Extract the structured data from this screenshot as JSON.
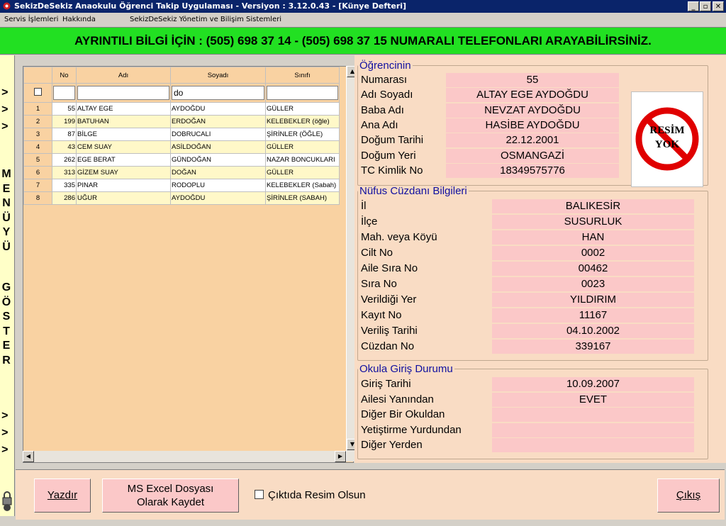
{
  "window": {
    "title": "SekizDeSekiz Anaokulu Öğrenci Takip Uygulaması - Versiyon : 3.12.0.43 - [Künye Defteri]",
    "min_label": "_",
    "max_label": "▫",
    "close_label": "✕"
  },
  "menu": {
    "items": [
      "Servis İşlemleri",
      "Hakkında",
      "SekizDeSekiz Yönetim ve Bilişim Sistemleri"
    ]
  },
  "banner": "AYRINTILI BİLGİ İÇİN : (505) 698 37 14 - (505) 698 37 15 NUMARALI TELEFONLARI ARAYABİLİRSİNİZ.",
  "sidebar": {
    "arrows": ">",
    "menu_letters": [
      "M",
      "E",
      "N",
      "Ü",
      "Y",
      "Ü"
    ],
    "show_letters": [
      "G",
      "Ö",
      "S",
      "T",
      "E",
      "R"
    ]
  },
  "grid": {
    "columns": [
      "No",
      "Adı",
      "Soyadı",
      "Sınıfı"
    ],
    "filter_soyadi": "do",
    "rows": [
      {
        "idx": "1",
        "no": "55",
        "adi": "ALTAY EGE",
        "soyadi": "AYDOĞDU",
        "sinifi": "GÜLLER"
      },
      {
        "idx": "2",
        "no": "199",
        "adi": "BATUHAN",
        "soyadi": "ERDOĞAN",
        "sinifi": "KELEBEKLER (öğle)"
      },
      {
        "idx": "3",
        "no": "87",
        "adi": "BİLGE",
        "soyadi": "DOBRUCALI",
        "sinifi": "ŞİRİNLER (ÖĞLE)"
      },
      {
        "idx": "4",
        "no": "43",
        "adi": "CEM SUAY",
        "soyadi": "ASİLDOĞAN",
        "sinifi": "GÜLLER"
      },
      {
        "idx": "5",
        "no": "262",
        "adi": "EGE BERAT",
        "soyadi": "GÜNDOĞAN",
        "sinifi": "NAZAR BONCUKLARI"
      },
      {
        "idx": "6",
        "no": "313",
        "adi": "GİZEM SUAY",
        "soyadi": "DOĞAN",
        "sinifi": "GÜLLER"
      },
      {
        "idx": "7",
        "no": "335",
        "adi": "PINAR",
        "soyadi": "RODOPLU",
        "sinifi": "KELEBEKLER (Sabah)"
      },
      {
        "idx": "8",
        "no": "286",
        "adi": "UĞUR",
        "soyadi": "AYDOĞDU",
        "sinifi": "ŞİRİNLER (SABAH)"
      }
    ]
  },
  "student": {
    "legend": "Öğrencinin",
    "fields": [
      {
        "label": "Numarası",
        "value": "55"
      },
      {
        "label": "Adı Soyadı",
        "value": "ALTAY EGE AYDOĞDU"
      },
      {
        "label": "Baba Adı",
        "value": "NEVZAT AYDOĞDU"
      },
      {
        "label": "Ana Adı",
        "value": "HASİBE AYDOĞDU"
      },
      {
        "label": "Doğum Tarihi",
        "value": "22.12.2001"
      },
      {
        "label": "Doğum Yeri",
        "value": "OSMANGAZİ"
      },
      {
        "label": "TC Kimlik No",
        "value": "18349575776"
      }
    ],
    "photo_text_1": "RESİM",
    "photo_text_2": "YOK"
  },
  "nufus": {
    "legend": "Nüfus Cüzdanı Bilgileri",
    "fields": [
      {
        "label": "İl",
        "value": "BALIKESİR"
      },
      {
        "label": "İlçe",
        "value": "SUSURLUK"
      },
      {
        "label": "Mah. veya Köyü",
        "value": "HAN"
      },
      {
        "label": "Cilt No",
        "value": "0002"
      },
      {
        "label": "Aile Sıra No",
        "value": "00462"
      },
      {
        "label": "Sıra No",
        "value": "0023"
      },
      {
        "label": "Verildiği Yer",
        "value": "YILDIRIM"
      },
      {
        "label": "Kayıt No",
        "value": "11167"
      },
      {
        "label": "Veriliş Tarihi",
        "value": "04.10.2002"
      },
      {
        "label": "Cüzdan No",
        "value": "339167"
      }
    ]
  },
  "okul": {
    "legend": "Okula Giriş Durumu",
    "fields": [
      {
        "label": "Giriş Tarihi",
        "value": "10.09.2007"
      },
      {
        "label": "Ailesi Yanından",
        "value": "EVET"
      },
      {
        "label": "Diğer Bir Okuldan",
        "value": ""
      },
      {
        "label": "Yetiştirme Yurdundan",
        "value": ""
      },
      {
        "label": "Diğer Yerden",
        "value": ""
      }
    ]
  },
  "bottom": {
    "print": "Yazdır",
    "excel_1": "MS Excel Dosyası",
    "excel_2": "Olarak Kaydet",
    "photo_option": "Çıktıda Resim Olsun",
    "exit": "Çıkış"
  },
  "colors": {
    "titlebar": "#0a246a",
    "banner": "#22e022",
    "field_bg": "#fbc8c8",
    "panel_bg": "#f9dcc4",
    "grid_bg": "#f9d2a2",
    "row_alt": "#fff8c8"
  }
}
